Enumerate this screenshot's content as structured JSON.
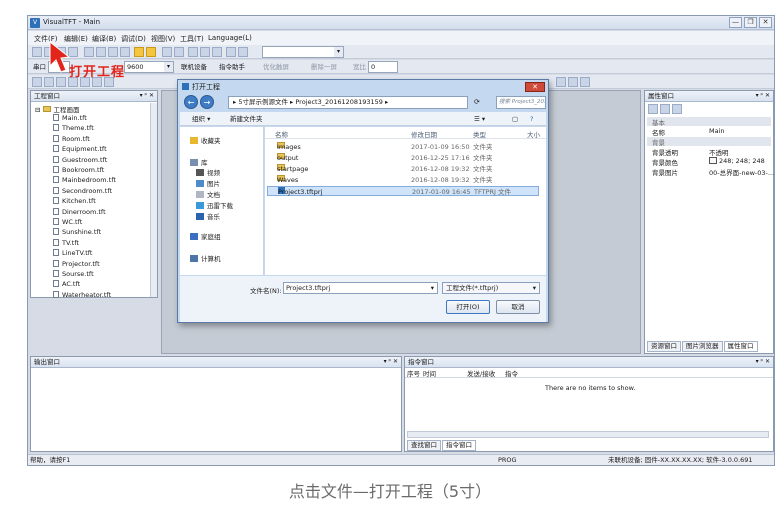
{
  "window": {
    "title": "VisualTFT - Main",
    "buttons": [
      "—",
      "❐",
      "✕"
    ]
  },
  "menu": [
    "文件(F)",
    "编辑(E)",
    "编译(B)",
    "调试(D)",
    "视图(V)",
    "工具(T)",
    "Language(L)"
  ],
  "toolbar2": {
    "port_label": "串口",
    "baud": "9600",
    "connect_label": "联机设备",
    "cmd_label": "指令助手",
    "disabled1": "优化触屏",
    "disabled2": "删除一屏",
    "zoom_label": "宽比",
    "zoom_value": "0"
  },
  "project_panel": {
    "title": "工程窗口",
    "root": "工程画面",
    "items": [
      "Main.tft",
      "Theme.tft",
      "Room.tft",
      "Equipment.tft",
      "Guestroom.tft",
      "Bookroom.tft",
      "Mainbedroom.tft",
      "Secondroom.tft",
      "Kitchen.tft",
      "Dinerroom.tft",
      "WC.tft",
      "Sunshine.tft",
      "TV.tft",
      "LineTV.tft",
      "Projector.tft",
      "Sourse.tft",
      "AC.tft",
      "Waterheator.tft"
    ]
  },
  "property_panel": {
    "title": "属性窗口",
    "rows": [
      {
        "k": "基本",
        "v": "",
        "section": true
      },
      {
        "k": "名称",
        "v": "Main",
        "section": false
      },
      {
        "k": "背景",
        "v": "",
        "section": true
      },
      {
        "k": "背景透明",
        "v": "不透明",
        "section": false
      },
      {
        "k": "背景颜色",
        "v": "248; 248; 248",
        "section": false
      },
      {
        "k": "背景图片",
        "v": "00-总界面-new-03-...",
        "section": false
      }
    ],
    "tabs": [
      "资源窗口",
      "图片浏览器",
      "属性窗口"
    ]
  },
  "output_panel": {
    "title": "输出窗口"
  },
  "command_panel": {
    "title": "指令窗口",
    "columns": [
      "序号",
      "时间",
      "发送/接收",
      "指令"
    ],
    "empty": "There are no items to show.",
    "tabs": [
      "查找窗口",
      "指令窗口"
    ]
  },
  "status": {
    "help": "帮助，请按F1",
    "mode": "PROG",
    "device": "未联机设备; 固件-XX.XX.XX.XX; 软件-3.0.0.691"
  },
  "dialog": {
    "title": "打开工程",
    "path": "▸ 5寸屏示例源文件 ▸ Project3_20161208193159 ▸",
    "search": "搜索 Project3_20161208193...",
    "organize": "组织 ▾",
    "new_folder": "新建文件夹",
    "nav": [
      {
        "label": "收藏夹",
        "icon": "star-icon"
      },
      {
        "label": "库",
        "icon": "library-icon"
      },
      {
        "label": "视频",
        "icon": "video-icon"
      },
      {
        "label": "图片",
        "icon": "picture-icon"
      },
      {
        "label": "文档",
        "icon": "document-icon"
      },
      {
        "label": "迅雷下载",
        "icon": "download-icon"
      },
      {
        "label": "音乐",
        "icon": "music-icon"
      },
      {
        "label": "家庭组",
        "icon": "homegroup-icon"
      },
      {
        "label": "计算机",
        "icon": "computer-icon"
      }
    ],
    "columns": [
      "名称",
      "修改日期",
      "类型",
      "大小"
    ],
    "files": [
      {
        "name": "Images",
        "date": "2017-01-09 16:50",
        "type": "文件夹",
        "folder": true
      },
      {
        "name": "output",
        "date": "2016-12-25 17:16",
        "type": "文件夹",
        "folder": true
      },
      {
        "name": "startpage",
        "date": "2016-12-08 19:32",
        "type": "文件夹",
        "folder": true
      },
      {
        "name": "Waves",
        "date": "2016-12-08 19:32",
        "type": "文件夹",
        "folder": true
      },
      {
        "name": "Project3.tftprj",
        "date": "2017-01-09 16:45",
        "type": "TFTPRJ 文件",
        "folder": false
      }
    ],
    "filename_label": "文件名(N):",
    "filename": "Project3.tftprj",
    "filetype": "工程文件(*.tftprj)",
    "open": "打开(O)",
    "cancel": "取消"
  },
  "annotation": "打开工程",
  "caption": "点击文件—打开工程（5寸）",
  "colors": {
    "annotation": "#e1251b",
    "highlight": "#cfe3fa"
  }
}
